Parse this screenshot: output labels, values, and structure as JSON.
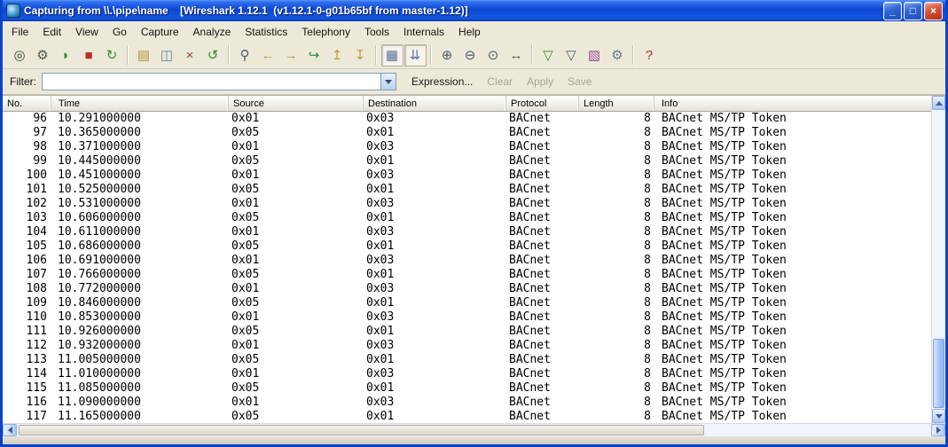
{
  "window": {
    "title": "Capturing from \\\\.\\pipe\\name    [Wireshark 1.12.1  (v1.12.1-0-g01b65bf from master-1.12)]",
    "controls": {
      "minimize": "_",
      "restore": "□",
      "close": "×"
    }
  },
  "theme": {
    "titlebar_blue": "#0d47d1",
    "chrome_background": "#ece9d8",
    "disabled_text": "#a8a494",
    "scrollbar_blue": "#aac7f8",
    "row_text": "#000000"
  },
  "menu": {
    "items": [
      "File",
      "Edit",
      "View",
      "Go",
      "Capture",
      "Analyze",
      "Statistics",
      "Telephony",
      "Tools",
      "Internals",
      "Help"
    ]
  },
  "toolbar": {
    "buttons": [
      {
        "name": "capture-interfaces",
        "glyph": "◎",
        "color": "#36502f"
      },
      {
        "name": "capture-options",
        "glyph": "⚙",
        "color": "#4a5a50"
      },
      {
        "name": "capture-start",
        "glyph": "◗",
        "color": "#2f8f3b"
      },
      {
        "name": "capture-stop",
        "glyph": "■",
        "color": "#c22b21"
      },
      {
        "name": "capture-restart",
        "glyph": "↻",
        "color": "#2f8f3b"
      },
      {
        "sep": true
      },
      {
        "name": "file-open",
        "glyph": "▤",
        "color": "#b58f3e"
      },
      {
        "name": "file-save",
        "glyph": "◫",
        "color": "#67839f"
      },
      {
        "name": "file-close",
        "glyph": "×",
        "color": "#9b3a2e"
      },
      {
        "name": "file-reload",
        "glyph": "↺",
        "color": "#2f8f3b"
      },
      {
        "sep": true
      },
      {
        "name": "find-packet",
        "glyph": "⚲",
        "color": "#4a5a6a"
      },
      {
        "name": "go-back",
        "glyph": "←",
        "color": "#c29b34"
      },
      {
        "name": "go-forward",
        "glyph": "→",
        "color": "#c29b34"
      },
      {
        "name": "goto-packet",
        "glyph": "↪",
        "color": "#2f8f3b"
      },
      {
        "name": "go-first-packet",
        "glyph": "↥",
        "color": "#c29b34"
      },
      {
        "name": "go-last-packet",
        "glyph": "↧",
        "color": "#c29b34"
      },
      {
        "sep": true
      },
      {
        "name": "colorize-packet-list",
        "glyph": "▦",
        "color": "#5b6f9e",
        "toggled": true
      },
      {
        "name": "autoscroll-live-capture",
        "glyph": "⇊",
        "color": "#5b6f9e",
        "toggled": true
      },
      {
        "sep": true
      },
      {
        "name": "zoom-in",
        "glyph": "⊕",
        "color": "#4a5a6a"
      },
      {
        "name": "zoom-out",
        "glyph": "⊖",
        "color": "#4a5a6a"
      },
      {
        "name": "zoom-100",
        "glyph": "⊙",
        "color": "#4a5a6a"
      },
      {
        "name": "resize-columns",
        "glyph": "↔",
        "color": "#4a5a6a"
      },
      {
        "sep": true
      },
      {
        "name": "capture-filter",
        "glyph": "▽",
        "color": "#2f8f3b"
      },
      {
        "name": "display-filter",
        "glyph": "▽",
        "color": "#4a5a6a"
      },
      {
        "name": "coloring-rules",
        "glyph": "▧",
        "color": "#a05090"
      },
      {
        "name": "preferences",
        "glyph": "⚙",
        "color": "#6b7a8d"
      },
      {
        "sep": true
      },
      {
        "name": "help",
        "glyph": "?",
        "color": "#b03030"
      }
    ]
  },
  "filter_bar": {
    "label": "Filter:",
    "value": "",
    "expression_label": "Expression...",
    "clear_label": "Clear",
    "apply_label": "Apply",
    "save_label": "Save"
  },
  "packet_list": {
    "columns": [
      {
        "key": "no",
        "label": "No."
      },
      {
        "key": "time",
        "label": "Time"
      },
      {
        "key": "source",
        "label": "Source"
      },
      {
        "key": "destination",
        "label": "Destination"
      },
      {
        "key": "protocol",
        "label": "Protocol"
      },
      {
        "key": "length",
        "label": "Length"
      },
      {
        "key": "info",
        "label": "Info"
      }
    ],
    "rows": [
      [
        "96",
        "10.291000000",
        "0x01",
        "0x03",
        "BACnet",
        "8",
        "BACnet MS/TP Token"
      ],
      [
        "97",
        "10.365000000",
        "0x05",
        "0x01",
        "BACnet",
        "8",
        "BACnet MS/TP Token"
      ],
      [
        "98",
        "10.371000000",
        "0x01",
        "0x03",
        "BACnet",
        "8",
        "BACnet MS/TP Token"
      ],
      [
        "99",
        "10.445000000",
        "0x05",
        "0x01",
        "BACnet",
        "8",
        "BACnet MS/TP Token"
      ],
      [
        "100",
        "10.451000000",
        "0x01",
        "0x03",
        "BACnet",
        "8",
        "BACnet MS/TP Token"
      ],
      [
        "101",
        "10.525000000",
        "0x05",
        "0x01",
        "BACnet",
        "8",
        "BACnet MS/TP Token"
      ],
      [
        "102",
        "10.531000000",
        "0x01",
        "0x03",
        "BACnet",
        "8",
        "BACnet MS/TP Token"
      ],
      [
        "103",
        "10.606000000",
        "0x05",
        "0x01",
        "BACnet",
        "8",
        "BACnet MS/TP Token"
      ],
      [
        "104",
        "10.611000000",
        "0x01",
        "0x03",
        "BACnet",
        "8",
        "BACnet MS/TP Token"
      ],
      [
        "105",
        "10.686000000",
        "0x05",
        "0x01",
        "BACnet",
        "8",
        "BACnet MS/TP Token"
      ],
      [
        "106",
        "10.691000000",
        "0x01",
        "0x03",
        "BACnet",
        "8",
        "BACnet MS/TP Token"
      ],
      [
        "107",
        "10.766000000",
        "0x05",
        "0x01",
        "BACnet",
        "8",
        "BACnet MS/TP Token"
      ],
      [
        "108",
        "10.772000000",
        "0x01",
        "0x03",
        "BACnet",
        "8",
        "BACnet MS/TP Token"
      ],
      [
        "109",
        "10.846000000",
        "0x05",
        "0x01",
        "BACnet",
        "8",
        "BACnet MS/TP Token"
      ],
      [
        "110",
        "10.853000000",
        "0x01",
        "0x03",
        "BACnet",
        "8",
        "BACnet MS/TP Token"
      ],
      [
        "111",
        "10.926000000",
        "0x05",
        "0x01",
        "BACnet",
        "8",
        "BACnet MS/TP Token"
      ],
      [
        "112",
        "10.932000000",
        "0x01",
        "0x03",
        "BACnet",
        "8",
        "BACnet MS/TP Token"
      ],
      [
        "113",
        "11.005000000",
        "0x05",
        "0x01",
        "BACnet",
        "8",
        "BACnet MS/TP Token"
      ],
      [
        "114",
        "11.010000000",
        "0x01",
        "0x03",
        "BACnet",
        "8",
        "BACnet MS/TP Token"
      ],
      [
        "115",
        "11.085000000",
        "0x05",
        "0x01",
        "BACnet",
        "8",
        "BACnet MS/TP Token"
      ],
      [
        "116",
        "11.090000000",
        "0x01",
        "0x03",
        "BACnet",
        "8",
        "BACnet MS/TP Token"
      ],
      [
        "117",
        "11.165000000",
        "0x05",
        "0x01",
        "BACnet",
        "8",
        "BACnet MS/TP Token"
      ]
    ]
  }
}
